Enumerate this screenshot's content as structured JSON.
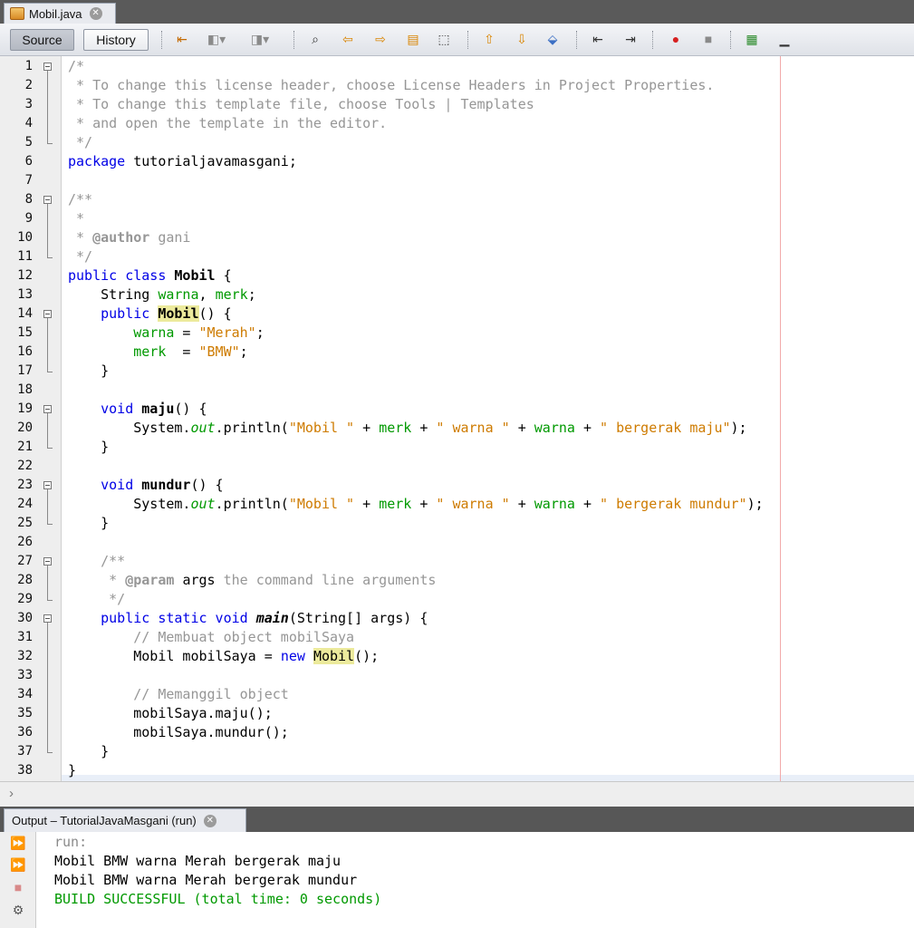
{
  "editor_tab": {
    "title": "Mobil.java"
  },
  "toolbar": {
    "source_label": "Source",
    "history_label": "History",
    "icons": [
      "last-edit-icon",
      "back-icon",
      "forward-icon",
      "find-icon",
      "find-previous-icon",
      "find-next-icon",
      "toggle-highlight-icon",
      "select-icon",
      "previous-bookmark-icon",
      "next-bookmark-icon",
      "toggle-bookmark-icon",
      "shift-left-icon",
      "shift-right-icon",
      "start-macro-icon",
      "stop-macro-icon",
      "comment-icon",
      "uncomment-icon"
    ]
  },
  "editor": {
    "line_numbers": [
      "1",
      "2",
      "3",
      "4",
      "5",
      "6",
      "7",
      "8",
      "9",
      "10",
      "11",
      "12",
      "13",
      "14",
      "15",
      "16",
      "17",
      "18",
      "19",
      "20",
      "21",
      "22",
      "23",
      "24",
      "25",
      "26",
      "27",
      "28",
      "29",
      "30",
      "31",
      "32",
      "33",
      "34",
      "35",
      "36",
      "37",
      "38"
    ],
    "code": {
      "l1": "/*",
      "l2": " * To change this license header, choose License Headers in Project Properties.",
      "l3": " * To change this template file, choose Tools | Templates",
      "l4": " * and open the template in the editor.",
      "l5": " */",
      "l6_kw": "package",
      "l6_rest": " tutorialjavamasgani;",
      "l8": "/**",
      "l9": " *",
      "l10_a": " * ",
      "l10_tag": "@author",
      "l10_b": " gani",
      "l11": " */",
      "l12_kw": "public class",
      "l12_sp": " ",
      "l12_name": "Mobil",
      "l12_rest": " {",
      "l13_a": "    String ",
      "l13_f1": "warna",
      "l13_b": ", ",
      "l13_f2": "merk",
      "l13_c": ";",
      "l14_a": "    ",
      "l14_kw": "public",
      "l14_b": " ",
      "l14_name": "Mobil",
      "l14_c": "() {",
      "l15_a": "        ",
      "l15_f": "warna",
      "l15_b": " = ",
      "l15_s": "\"Merah\"",
      "l15_c": ";",
      "l16_a": "        ",
      "l16_f": "merk",
      "l16_b": "  = ",
      "l16_s": "\"BMW\"",
      "l16_c": ";",
      "l17": "    }",
      "l19_a": "    ",
      "l19_kw": "void",
      "l19_b": " ",
      "l19_name": "maju",
      "l19_c": "() {",
      "l20_a": "        System.",
      "l20_out": "out",
      "l20_b": ".println(",
      "l20_s1": "\"Mobil \"",
      "l20_p1": " + ",
      "l20_f1": "merk",
      "l20_p2": " + ",
      "l20_s2": "\" warna \"",
      "l20_p3": " + ",
      "l20_f2": "warna",
      "l20_p4": " + ",
      "l20_s3": "\" bergerak maju\"",
      "l20_c": ");",
      "l21": "    }",
      "l23_a": "    ",
      "l23_kw": "void",
      "l23_b": " ",
      "l23_name": "mundur",
      "l23_c": "() {",
      "l24_a": "        System.",
      "l24_out": "out",
      "l24_b": ".println(",
      "l24_s1": "\"Mobil \"",
      "l24_p1": " + ",
      "l24_f1": "merk",
      "l24_p2": " + ",
      "l24_s2": "\" warna \"",
      "l24_p3": " + ",
      "l24_f2": "warna",
      "l24_p4": " + ",
      "l24_s3": "\" bergerak mundur\"",
      "l24_c": ");",
      "l25": "    }",
      "l27": "    /**",
      "l28_a": "     * ",
      "l28_tag": "@param",
      "l28_b": " ",
      "l28_arg": "args",
      "l28_c": " the command line arguments",
      "l29": "     */",
      "l30_a": "    ",
      "l30_kw": "public static void",
      "l30_b": " ",
      "l30_name": "main",
      "l30_c": "(String[] args) {",
      "l31": "        // Membuat object mobilSaya",
      "l32_a": "        Mobil mobilSaya = ",
      "l32_kw": "new",
      "l32_b": " ",
      "l32_name": "Mobil",
      "l32_c": "();",
      "l34": "        // Memanggil object",
      "l35": "        mobilSaya.maju();",
      "l36": "        mobilSaya.mundur();",
      "l37": "    }",
      "l38": "}"
    }
  },
  "output": {
    "tab_title": "Output – TutorialJavaMasgani (run)",
    "lines": [
      "run:",
      "Mobil BMW warna Merah bergerak maju",
      "Mobil BMW warna Merah bergerak mundur",
      "BUILD SUCCESSFUL (total time: 0 seconds)"
    ],
    "icons": [
      "rerun-icon",
      "rerun-different-icon",
      "stop-icon",
      "settings-icon"
    ]
  },
  "colors": {
    "keyword": "#0000e6",
    "comment": "#969696",
    "string": "#ce7b00",
    "field": "#009900",
    "build_success": "#009900"
  }
}
